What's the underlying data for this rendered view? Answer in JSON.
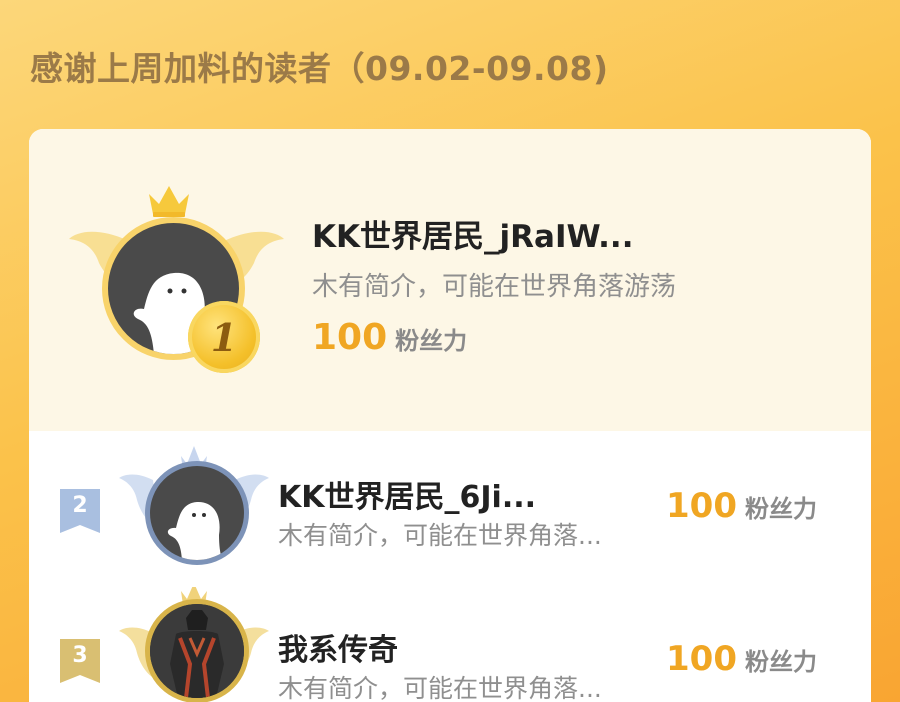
{
  "header": {
    "title": "感谢上周加料的读者（09.02-09.08)"
  },
  "colors": {
    "accent": "#f0a623",
    "gold": "#f4c02a",
    "silver": "#7d93b8",
    "bronze": "#d8b44a"
  },
  "leaderboard": {
    "top": {
      "rank": "1",
      "name": "KK世界居民_jRaIW...",
      "desc": "木有简介，可能在世界角落游荡",
      "fans_value": "100",
      "fans_label": "粉丝力"
    },
    "rows": [
      {
        "rank": "2",
        "name": "KK世界居民_6Ji...",
        "desc": "木有简介，可能在世界角落...",
        "fans_value": "100",
        "fans_label": "粉丝力"
      },
      {
        "rank": "3",
        "name": "我系传奇",
        "desc": "木有简介，可能在世界角落...",
        "fans_value": "100",
        "fans_label": "粉丝力"
      }
    ]
  }
}
